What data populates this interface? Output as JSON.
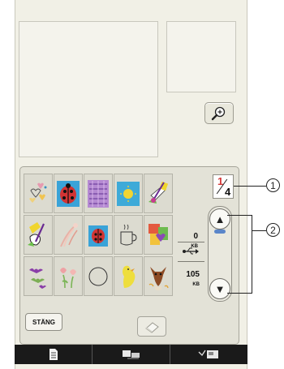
{
  "zoom_button": {
    "icon": "magnifier-plus-icon"
  },
  "page_indicator": {
    "current": "1",
    "total": "4"
  },
  "scroll": {
    "up_icon": "▲",
    "down_icon": "▼"
  },
  "memory": {
    "used_value": "0",
    "used_unit": "KB",
    "free_value": "105",
    "free_unit": "KB",
    "device_icon": "usb-icon"
  },
  "grid": {
    "cells": [
      {
        "name": "hearts-pattern"
      },
      {
        "name": "ladybug-pattern"
      },
      {
        "name": "purple-lace-pattern"
      },
      {
        "name": "sun-pattern"
      },
      {
        "name": "guitar-pattern"
      },
      {
        "name": "guitar-large-pattern"
      },
      {
        "name": "comet-pattern"
      },
      {
        "name": "ladybug-small-pattern"
      },
      {
        "name": "mug-pattern"
      },
      {
        "name": "patchwork-heart-pattern"
      },
      {
        "name": "bats-pattern"
      },
      {
        "name": "tulips-pattern"
      },
      {
        "name": "circle-outline-pattern"
      },
      {
        "name": "yellow-bird-pattern"
      },
      {
        "name": "deer-pattern"
      }
    ]
  },
  "buttons": {
    "close_label": "STÄNG",
    "erase_icon": "eraser-icon"
  },
  "tabs": [
    {
      "icon": "document-icon"
    },
    {
      "icon": "transfer-icon"
    },
    {
      "icon": "machine-icon"
    }
  ],
  "callouts": [
    "1",
    "2"
  ]
}
